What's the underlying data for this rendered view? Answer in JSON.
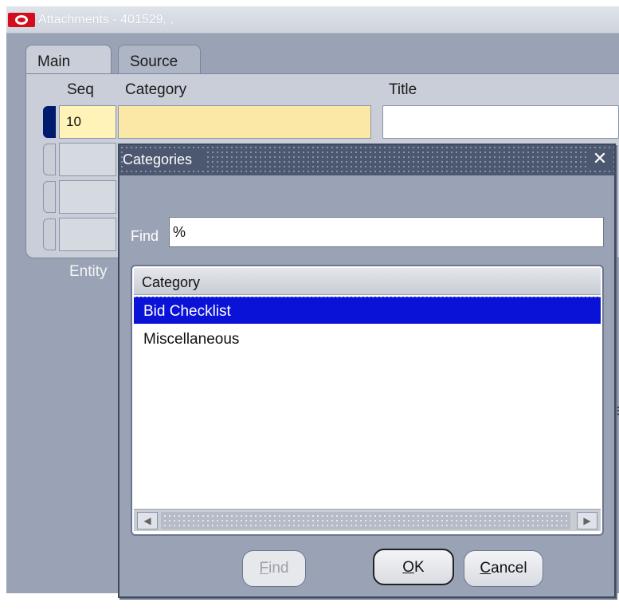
{
  "window": {
    "title": "Attachments - 401529, ,",
    "tabs": [
      "Main",
      "Source"
    ]
  },
  "main_panel": {
    "columns": [
      "Seq",
      "Category",
      "Title"
    ],
    "rows": [
      {
        "seq": "10",
        "category": "",
        "title": ""
      },
      {
        "seq": "",
        "category": "",
        "title": ""
      },
      {
        "seq": "",
        "category": "",
        "title": ""
      },
      {
        "seq": "",
        "category": "",
        "title": ""
      }
    ],
    "entity_label": "Entity",
    "right_edge_fragment": "e"
  },
  "dialog": {
    "title": "Categories",
    "find_label": "Find",
    "find_value": "%",
    "list_header": "Category",
    "items": [
      "Bid Checklist",
      "Miscellaneous"
    ],
    "selected_index": 0,
    "buttons": {
      "find": {
        "mnemonic": "F",
        "rest": "ind",
        "enabled": false
      },
      "ok": {
        "mnemonic": "O",
        "rest": "K"
      },
      "cancel": {
        "mnemonic": "C",
        "rest": "ancel"
      }
    }
  },
  "icons": {
    "app": "oracle-logo-icon",
    "close": "close-icon",
    "scroll_left": "scroll-left-icon",
    "scroll_right": "scroll-right-icon"
  },
  "colors": {
    "selection": "#0a12d8",
    "active_field": "#fce8a6",
    "record_indicator": "#001a6e"
  }
}
